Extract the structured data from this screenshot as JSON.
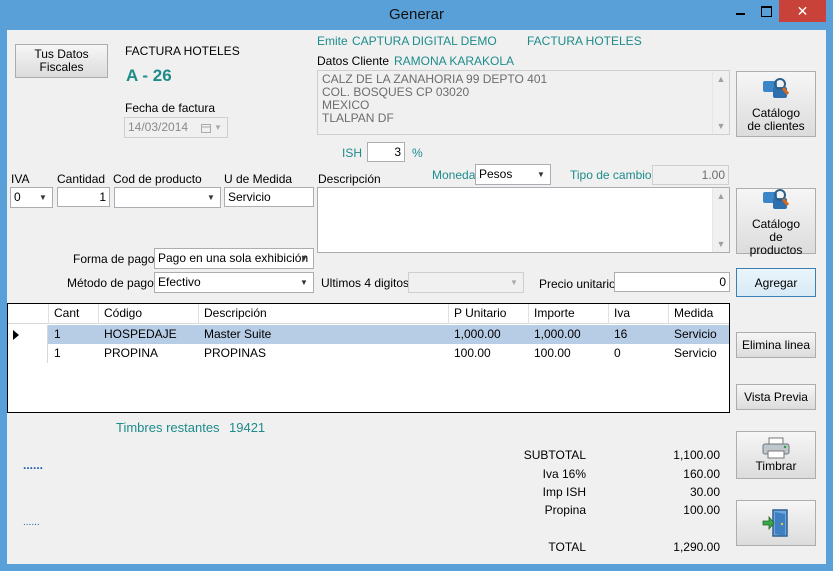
{
  "window": {
    "title": "Generar",
    "close_glyph": "✕"
  },
  "fiscal_button": "Tus Datos Fiscales",
  "invoice": {
    "type_label": "FACTURA HOTELES",
    "number": "A - 26",
    "date_label": "Fecha de factura",
    "date_value": "14/03/2014"
  },
  "emitter": {
    "label": "Emite",
    "value": "CAPTURA DIGITAL DEMO",
    "type": "FACTURA HOTELES"
  },
  "client": {
    "label": "Datos Cliente",
    "name": "RAMONA KARAKOLA",
    "address_lines": [
      "CALZ DE LA ZANAHORIA 99 DEPTO 401",
      "COL. BOSQUES   CP 03020",
      "MEXICO",
      "TLALPAN   DF"
    ],
    "catalog_button": "Catálogo de clientes"
  },
  "ish": {
    "label": "ISH",
    "value": "3",
    "unit": "%"
  },
  "fields": {
    "iva_label": "IVA",
    "iva_value": "0",
    "cantidad_label": "Cantidad",
    "cantidad_value": "1",
    "cod_label": "Cod de producto",
    "cod_value": "",
    "medida_label": "U de Medida",
    "medida_value": "Servicio",
    "descripcion_label": "Descripción",
    "moneda_label": "Moneda",
    "moneda_value": "Pesos",
    "tipo_cambio_label": "Tipo de cambio",
    "tipo_cambio_value": "1.00",
    "products_button": "Catálogo de productos",
    "forma_pago_label": "Forma de pago",
    "forma_pago_value": "Pago en una sola exhibición",
    "metodo_pago_label": "Método de pago",
    "metodo_pago_value": "Efectivo",
    "ultimos_label": "Ultimos 4 digitos",
    "ultimos_value": "",
    "precio_label": "Precio unitario",
    "precio_value": "0",
    "agregar_button": "Agregar"
  },
  "table": {
    "columns": [
      "Cant",
      "Código",
      "Descripción",
      "P Unitario",
      "Importe",
      "Iva",
      "Medida"
    ],
    "rows": [
      [
        "1",
        "HOSPEDAJE",
        "Master Suite",
        "1,000.00",
        "1,000.00",
        "16",
        "Servicio"
      ],
      [
        "1",
        "PROPINA",
        "PROPINAS",
        "100.00",
        "100.00",
        "0",
        "Servicio"
      ]
    ]
  },
  "side_buttons": {
    "elimina": "Elimina linea",
    "vista": "Vista Previa",
    "timbrar": "Timbrar"
  },
  "timbres": {
    "label": "Timbres restantes",
    "value": "19421"
  },
  "dots1": "......",
  "dots2": "......",
  "totals": {
    "subtotal_label": "SUBTOTAL",
    "subtotal": "1,100.00",
    "iva_label": "Iva 16%",
    "iva": "160.00",
    "ish_label": "Imp ISH",
    "ish": "30.00",
    "propina_label": "Propina",
    "propina": "100.00",
    "total_label": "TOTAL",
    "total": "1,290.00"
  },
  "colors": {
    "accent": "#1e8b8b",
    "titlebar": "#5aa0d8",
    "close": "#c8423a",
    "selection": "#b7cde6"
  }
}
